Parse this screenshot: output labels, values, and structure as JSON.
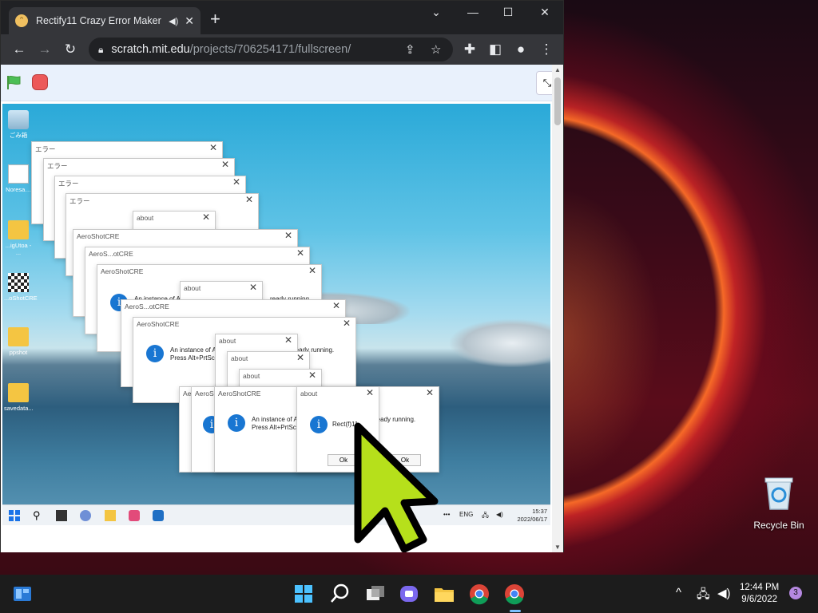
{
  "browser": {
    "tab_title": "Rectify11 Crazy Error Maker",
    "favicon": "scratch-cat-icon",
    "url_host": "scratch.mit.edu",
    "url_path": "/projects/706254171/fullscreen/",
    "new_tab_label": "+",
    "controls": {
      "minimize": "—",
      "maximize": "☐",
      "close": "✕",
      "tab_search": "⌄"
    }
  },
  "stage": {
    "desktop_icons": [
      {
        "label": "ごみ箱",
        "icon": "recycle-bin-icon"
      },
      {
        "label": "Noresa…",
        "icon": "document-icon"
      },
      {
        "label": "...igUtoa - ...",
        "icon": "folder-icon"
      },
      {
        "label": "...oShotCRE",
        "icon": "checkered-app-icon"
      },
      {
        "label": "ppshot",
        "icon": "folder-icon"
      },
      {
        "label": "savedata...",
        "icon": "folder-icon"
      }
    ],
    "dialogs_error": [
      {
        "title": "エラー"
      },
      {
        "title": "エラー"
      },
      {
        "title": "エラー"
      },
      {
        "title": "エラー"
      }
    ],
    "dialogs_aeroshot": [
      {
        "title": "AeroShotCRE"
      },
      {
        "title": "AeroS...otCRE"
      },
      {
        "title": "AeroShotCRE"
      },
      {
        "title": "AeroS...otCRE"
      },
      {
        "title": "AeroShotCRE"
      }
    ],
    "main_message_line1": "An instance of A",
    "main_message_tail": "ready running.",
    "main_message_line2": "Press Alt+PrtSc",
    "about_title": "about",
    "about_message": "Rect(f)11",
    "ok_label": "Ok",
    "taskbar_tray": {
      "more": "•••",
      "lang": "ENG",
      "time": "15:37",
      "date": "2022/06/17"
    }
  },
  "desktop": {
    "recycle_bin_label": "Recycle Bin"
  },
  "taskbar": {
    "clock_time": "12:44 PM",
    "clock_date": "9/6/2022",
    "notification_count": "3",
    "chevron": "^"
  }
}
